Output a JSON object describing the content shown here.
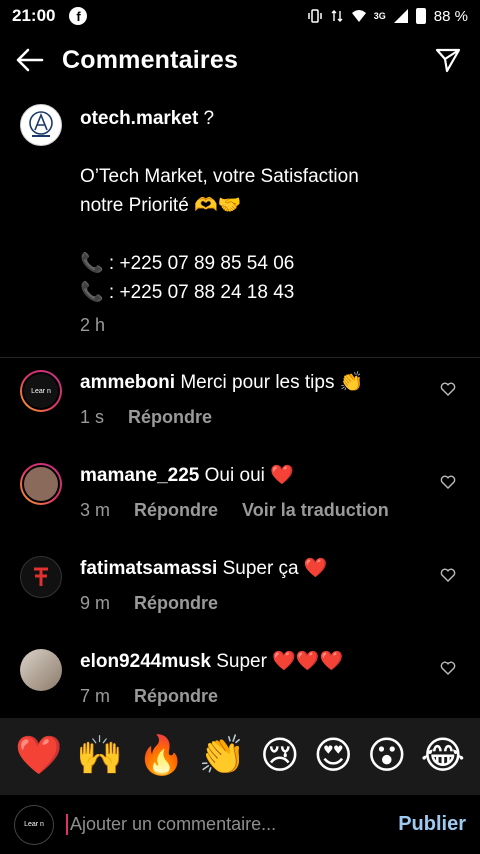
{
  "status": {
    "time": "21:00",
    "battery": "88 %",
    "network": "3G"
  },
  "header": {
    "title": "Commentaires"
  },
  "caption": {
    "username": "otech.market",
    "after_username": " ?",
    "line1": "O’Tech Market, votre Satisfaction",
    "line2": "notre Priorité 🫶🤝",
    "phone1": "📞 : +225 07 89 85 54 06",
    "phone2": "📞 : +225 07 88 24 18 43",
    "time": "2 h"
  },
  "comments": [
    {
      "username": "ammeboni",
      "text": "Merci pour les tips 👏",
      "time": "1 s",
      "reply": "Répondre",
      "translate": ""
    },
    {
      "username": "mamane_225",
      "text": "Oui oui ❤️",
      "time": "3 m",
      "reply": "Répondre",
      "translate": "Voir la traduction"
    },
    {
      "username": "fatimatsamassi",
      "text": "Super ça ❤️",
      "time": "9 m",
      "reply": "Répondre",
      "translate": ""
    },
    {
      "username": "elon9244musk",
      "text": "Super ❤️❤️❤️",
      "time": "7 m",
      "reply": "Répondre",
      "translate": ""
    }
  ],
  "emojis": [
    "❤️",
    "🙌",
    "🔥",
    "👏",
    "😢",
    "😍",
    "😮",
    "😂"
  ],
  "input": {
    "placeholder": "Ajouter un commentaire...",
    "post_label": "Publier"
  },
  "colors": {
    "background": "#000000",
    "muted_text": "#9a9a9a",
    "post_button": "#9ec9f0",
    "heart": "#ff3040"
  }
}
